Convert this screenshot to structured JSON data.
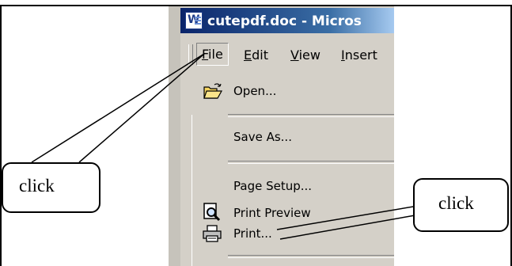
{
  "window": {
    "title": "cutepdf.doc - Micros",
    "app_icon": "word-document-icon"
  },
  "menubar": {
    "items": [
      {
        "label": "File",
        "mnemonic_index": 0
      },
      {
        "label": "Edit",
        "mnemonic_index": 0
      },
      {
        "label": "View",
        "mnemonic_index": 0
      },
      {
        "label": "Insert",
        "mnemonic_index": 0
      }
    ]
  },
  "file_menu": {
    "items": [
      {
        "label": "Open...",
        "icon": "open-folder-icon"
      },
      {
        "label": "Save As..."
      },
      {
        "label": "Page Setup..."
      },
      {
        "label": "Print Preview",
        "icon": "print-preview-icon"
      },
      {
        "label": "Print...",
        "icon": "printer-icon"
      }
    ]
  },
  "annotations": {
    "callout_file": "click",
    "callout_print": "click"
  },
  "colors": {
    "titlebar": "#0a246a",
    "chrome": "#d4d0c8",
    "frame": "#000000"
  }
}
